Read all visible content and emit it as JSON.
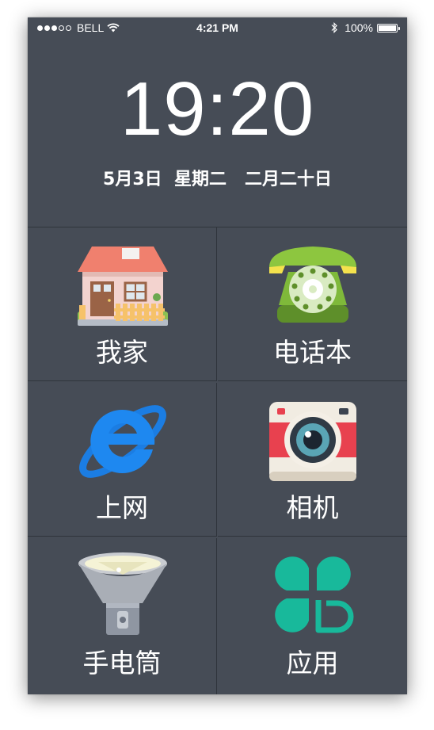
{
  "status_bar": {
    "signal_bars_filled": 3,
    "signal_bars_total": 5,
    "carrier": "BELL",
    "time": "4:21 PM",
    "battery_percent": "100%",
    "battery_level": 1.0
  },
  "lock": {
    "clock": "19:20",
    "date": "5月3日  星期二   二月二十日"
  },
  "apps": [
    {
      "label": "我家",
      "icon": "house-icon"
    },
    {
      "label": "电话本",
      "icon": "telephone-icon"
    },
    {
      "label": "上网",
      "icon": "internet-explorer-icon"
    },
    {
      "label": "相机",
      "icon": "camera-icon"
    },
    {
      "label": "手电筒",
      "icon": "flashlight-icon"
    },
    {
      "label": "应用",
      "icon": "apps-clover-icon"
    }
  ],
  "colors": {
    "background": "#464c56",
    "grid_line": "#2f343b",
    "text": "#ffffff"
  }
}
